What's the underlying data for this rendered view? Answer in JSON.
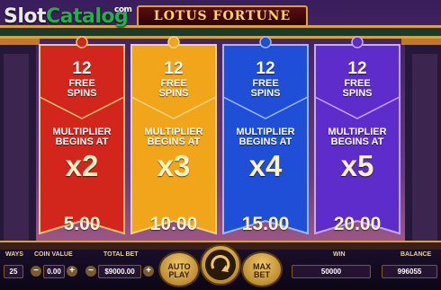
{
  "watermark": {
    "part1": "Slot",
    "part2": "Catalog",
    "suffix": "com"
  },
  "title": "LOTUS FORTUNE",
  "banners": [
    {
      "spins": "12",
      "free_label_1": "FREE",
      "free_label_2": "SPINS",
      "mult_label_1": "MULTIPLIER",
      "mult_label_2": "BEGINS AT",
      "multiplier": "x2",
      "value": "5.00",
      "color": "red"
    },
    {
      "spins": "12",
      "free_label_1": "FREE",
      "free_label_2": "SPINS",
      "mult_label_1": "MULTIPLIER",
      "mult_label_2": "BEGINS AT",
      "multiplier": "x3",
      "value": "10.00",
      "color": "orange"
    },
    {
      "spins": "12",
      "free_label_1": "FREE",
      "free_label_2": "SPINS",
      "mult_label_1": "MULTIPLIER",
      "mult_label_2": "BEGINS AT",
      "multiplier": "x4",
      "value": "15.00",
      "color": "blue"
    },
    {
      "spins": "12",
      "free_label_1": "FREE",
      "free_label_2": "SPINS",
      "mult_label_1": "MULTIPLIER",
      "mult_label_2": "BEGINS AT",
      "multiplier": "x5",
      "value": "20.00",
      "color": "purple"
    }
  ],
  "colors": {
    "red": "#d2261c",
    "orange": "#f0a51b",
    "blue": "#1f4fd6",
    "purple": "#5f2ccc",
    "gold": "#d9a33b"
  },
  "hud": {
    "ways_label": "WAYS",
    "ways_value": "25",
    "coin_label": "COIN VALUE",
    "coin_value": "0.00",
    "total_bet_label": "TOTAL BET",
    "total_bet_value": "$9000.00",
    "autoplay_1": "AUTO",
    "autoplay_2": "PLAY",
    "maxbet_1": "MAX",
    "maxbet_2": "BET",
    "win_label": "WIN",
    "win_value": "50000",
    "balance_label": "BALANCE",
    "balance_value": "996055",
    "minus": "−",
    "plus": "+",
    "spin_icon": "spin-arrow-icon"
  }
}
